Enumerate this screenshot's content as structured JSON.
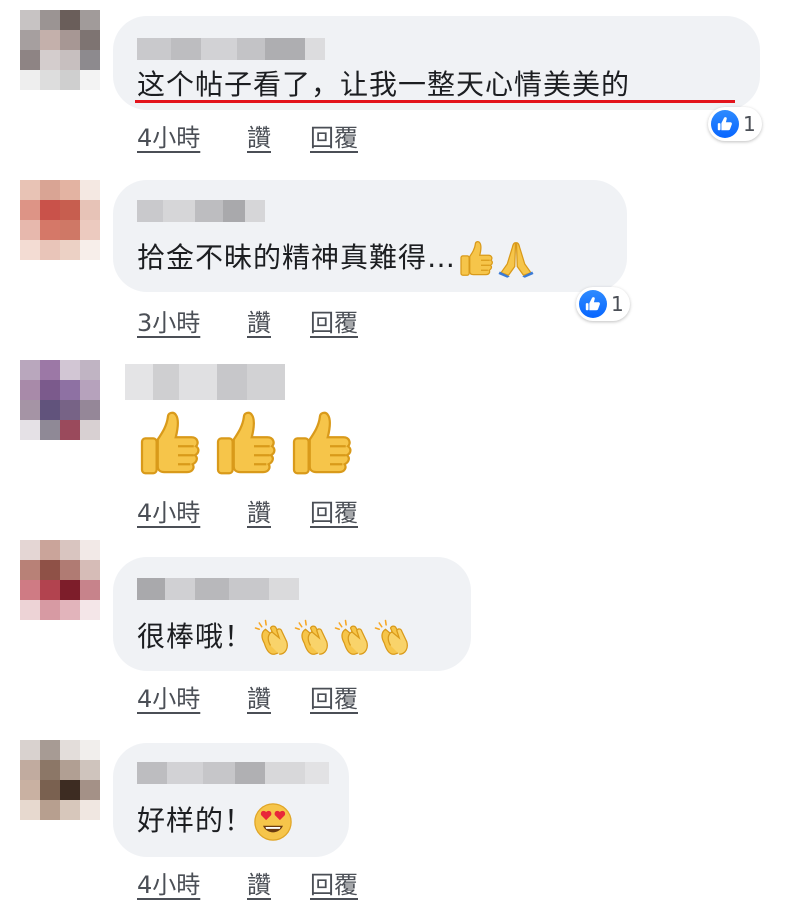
{
  "colors": {
    "bubble": "#f0f2f5",
    "text": "#1c1e21",
    "meta": "#4b4f56",
    "like_blue": "#0866ff",
    "underline_red": "#e3141c"
  },
  "comments": [
    {
      "text": "这个帖子看了，让我一整天心情美美的",
      "time": "4小時",
      "like": "讚",
      "reply": "回覆",
      "reaction_count": "1"
    },
    {
      "text": "拾金不昧的精神真難得…",
      "time": "3小時",
      "like": "讚",
      "reply": "回覆",
      "reaction_count": "1",
      "emojis": [
        "thumbs-up",
        "folded-hands"
      ]
    },
    {
      "text": "",
      "time": "4小時",
      "like": "讚",
      "reply": "回覆",
      "emojis": [
        "thumbs-up",
        "thumbs-up",
        "thumbs-up"
      ]
    },
    {
      "text": "很棒哦！",
      "time": "4小時",
      "like": "讚",
      "reply": "回覆",
      "emojis": [
        "clapping-hands",
        "clapping-hands",
        "clapping-hands",
        "clapping-hands"
      ]
    },
    {
      "text": "好样的！",
      "time": "4小時",
      "like": "讚",
      "reply": "回覆",
      "emojis": [
        "heart-eyes-face"
      ]
    }
  ]
}
